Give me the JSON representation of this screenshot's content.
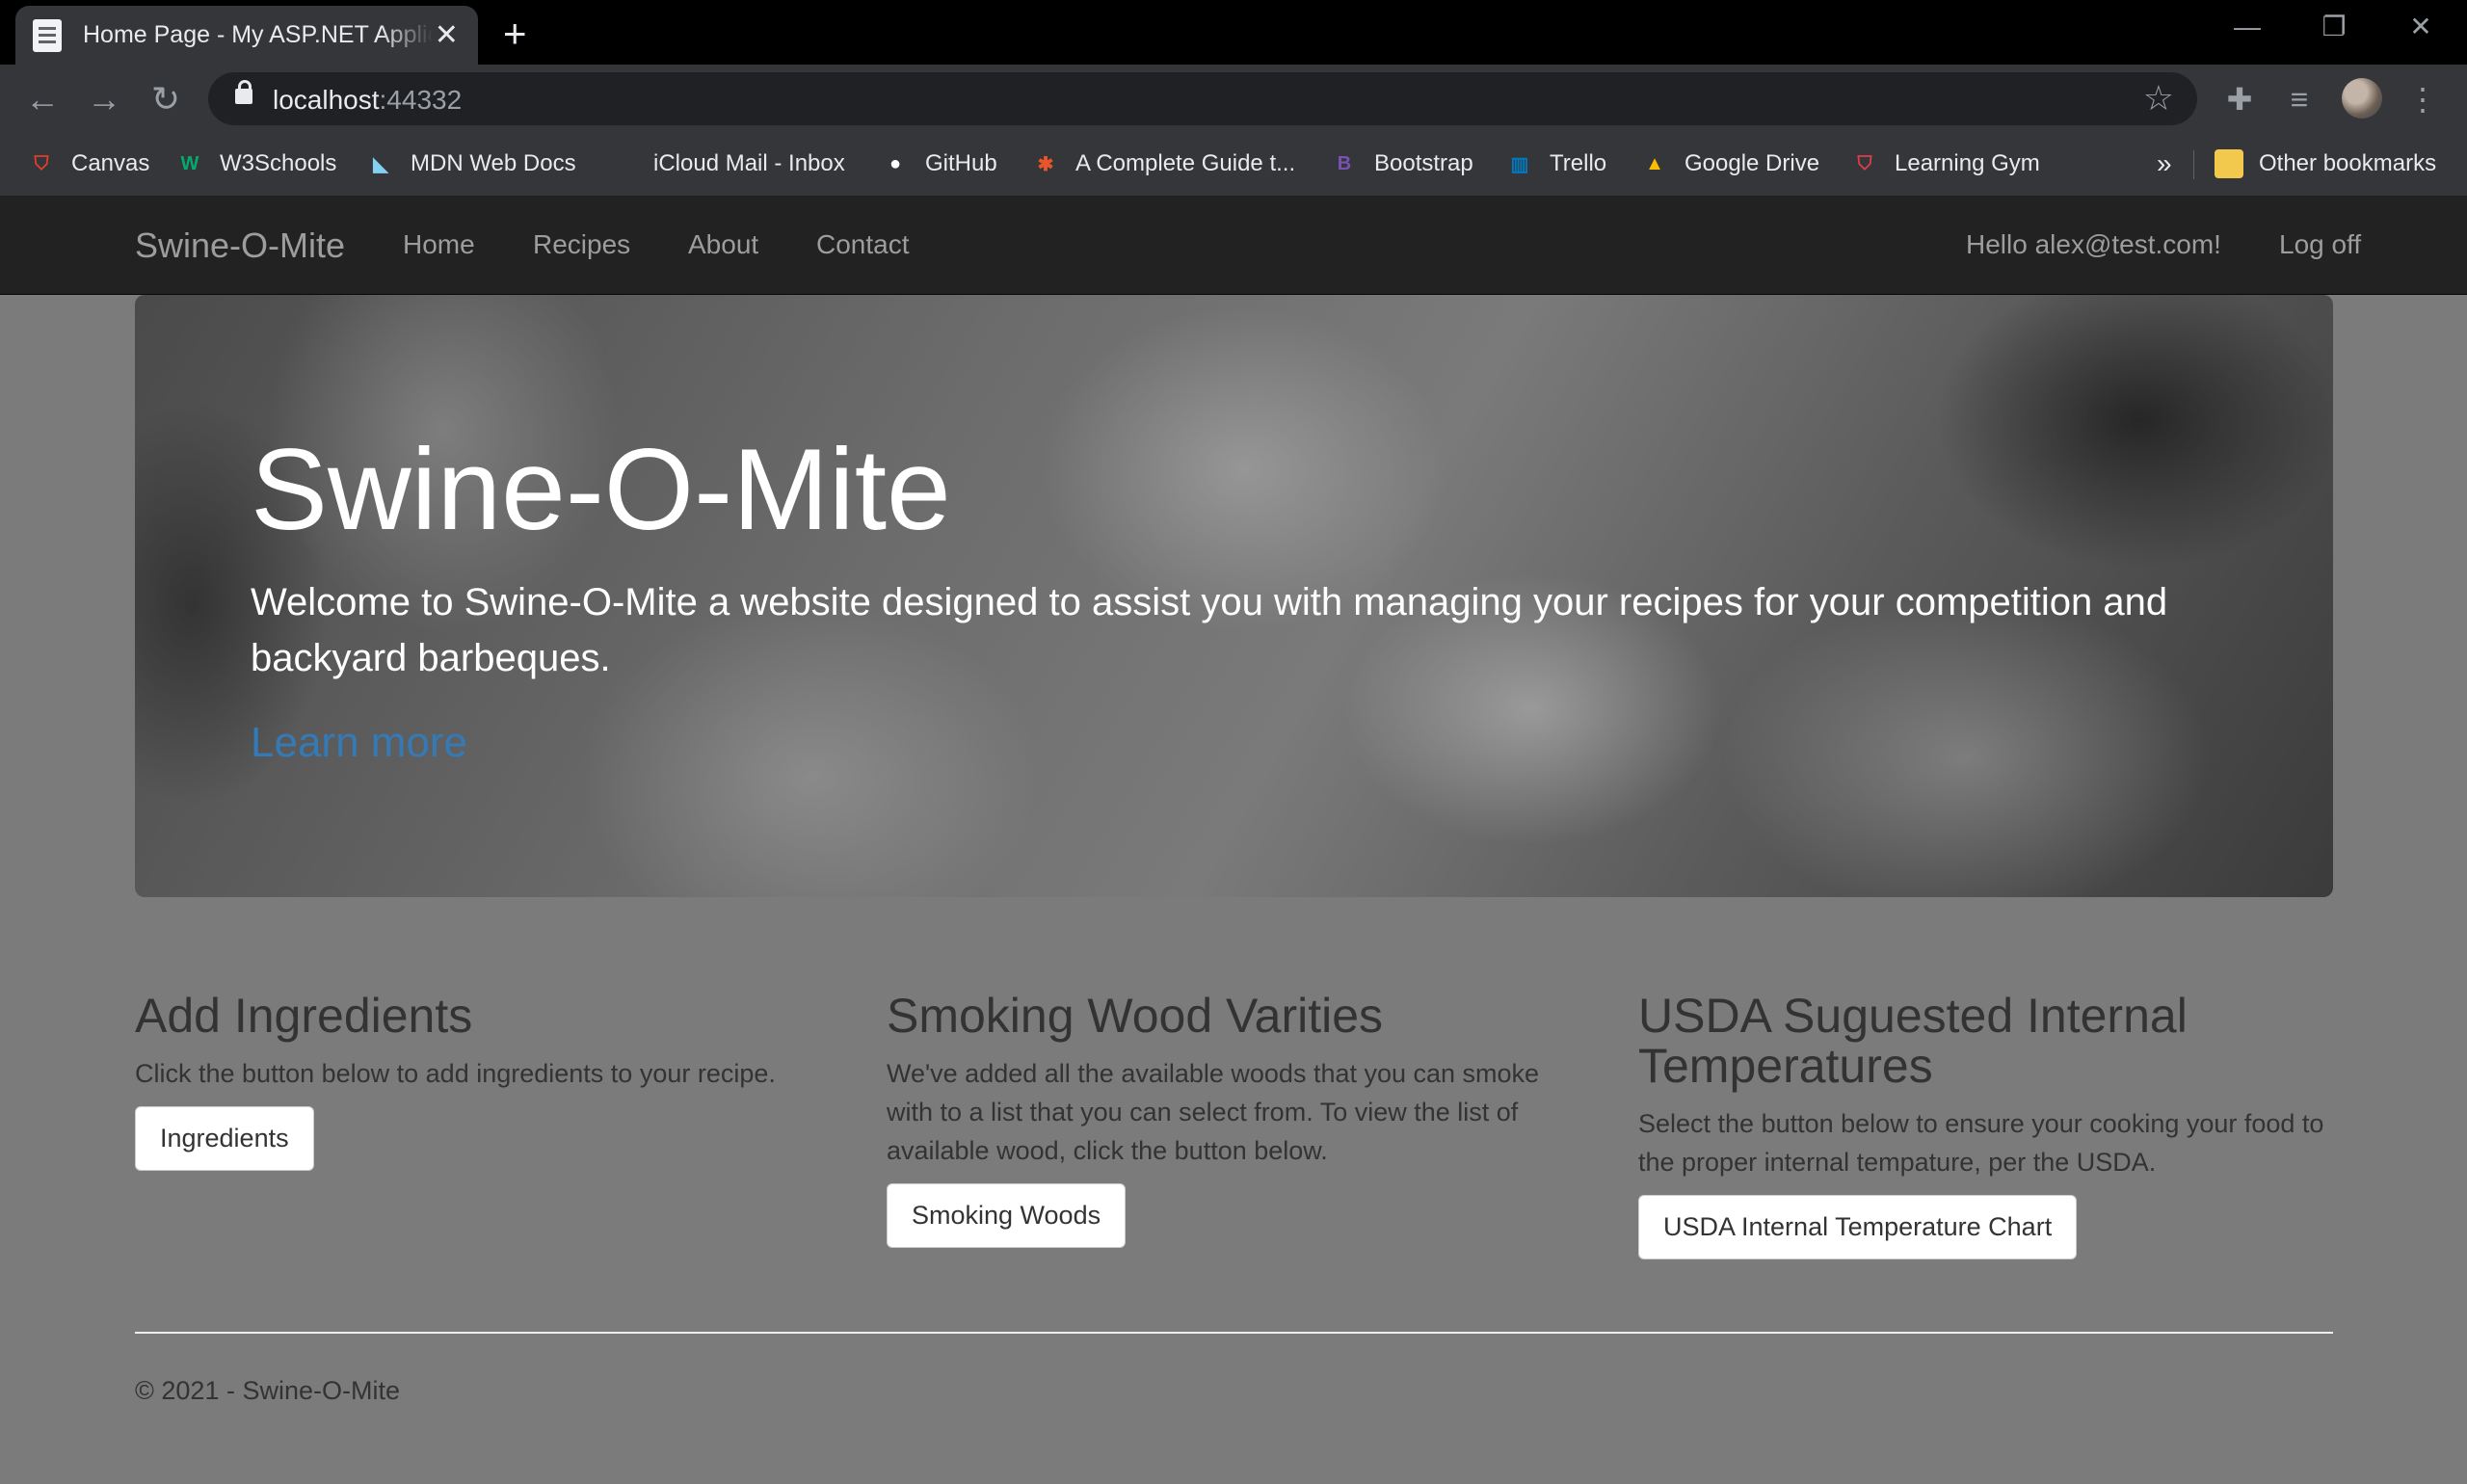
{
  "browser": {
    "tab_title": "Home Page - My ASP.NET Application",
    "tab_close": "✕",
    "new_tab": "+",
    "url_host": "localhost",
    "url_port": ":44332",
    "bookmarks": [
      {
        "label": "Canvas",
        "icon": "canvas-icon",
        "color": "#e13f2b"
      },
      {
        "label": "W3Schools",
        "icon": "w3schools-icon",
        "color": "#04aa6d"
      },
      {
        "label": "MDN Web Docs",
        "icon": "mdn-icon",
        "color": "#83d0f2"
      },
      {
        "label": "iCloud Mail - Inbox",
        "icon": "apple-icon",
        "color": "#9aa0a6"
      },
      {
        "label": "GitHub",
        "icon": "github-icon",
        "color": "#ffffff"
      },
      {
        "label": "A Complete Guide t...",
        "icon": "css-tricks-icon",
        "color": "#e8552b"
      },
      {
        "label": "Bootstrap",
        "icon": "bootstrap-icon",
        "color": "#7952b3"
      },
      {
        "label": "Trello",
        "icon": "trello-icon",
        "color": "#0079bf"
      },
      {
        "label": "Google Drive",
        "icon": "google-drive-icon",
        "color": "#fbbc04"
      },
      {
        "label": "Learning Gym",
        "icon": "learning-gym-icon",
        "color": "#e03c4b"
      }
    ],
    "bookmarks_more": "»",
    "other_bookmarks": "Other bookmarks"
  },
  "site": {
    "brand": "Swine-O-Mite",
    "nav": [
      "Home",
      "Recipes",
      "About",
      "Contact"
    ],
    "greeting": "Hello alex@test.com!",
    "logoff": "Log off",
    "hero": {
      "title": "Swine-O-Mite",
      "lead": "Welcome to Swine-O-Mite a website designed to assist you with managing your recipes for your competition and backyard barbeques.",
      "link": "Learn more",
      "link_color": "#337ab7"
    },
    "columns": [
      {
        "heading": "Add Ingredients",
        "text": "Click the button below to add ingredients to your recipe.",
        "button": "Ingredients"
      },
      {
        "heading": "Smoking Wood Varities",
        "text": "We've added all the available woods that you can smoke with to a list that you can select from. To view the list of available wood, click the button below.",
        "button": "Smoking Woods"
      },
      {
        "heading": "USDA Suguested Internal Temperatures",
        "text": "Select the button below to ensure your cooking your food to the proper internal tempature, per the USDA.",
        "button": "USDA Internal Temperature Chart"
      }
    ],
    "footer": "© 2021 - Swine-O-Mite"
  }
}
